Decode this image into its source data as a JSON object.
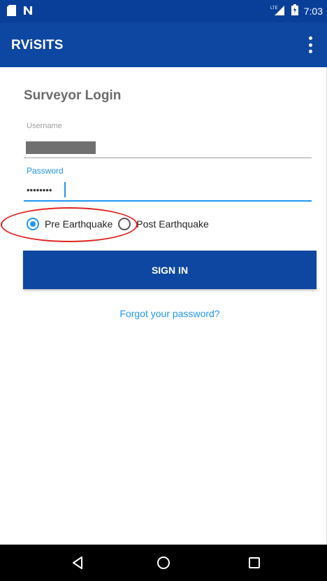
{
  "status_bar": {
    "time": "7:03",
    "left_icons": [
      "sd-card-icon",
      "nfc-icon"
    ],
    "right_icons": [
      "lte-signal-icon",
      "battery-icon"
    ]
  },
  "app_bar": {
    "title": "RViSITS",
    "menu_icon": "overflow-menu-icon"
  },
  "login_form": {
    "title": "Surveyor Login",
    "username": {
      "label": "Username",
      "value_redacted": true
    },
    "password": {
      "label": "Password",
      "masked_value": "••••••••"
    },
    "mode_options": [
      {
        "label": "Pre Earthquake",
        "selected": true
      },
      {
        "label": "Post Earthquake",
        "selected": false
      }
    ],
    "sign_in_label": "SIGN IN",
    "forgot_password_label": "Forgot your password?"
  },
  "nav_bar": {
    "buttons": [
      "back-icon",
      "home-icon",
      "recents-icon"
    ]
  },
  "colors": {
    "primary": "#0d47a1",
    "status_bar": "#0a3f99",
    "accent": "#2196f3",
    "annotation": "#e02424"
  }
}
